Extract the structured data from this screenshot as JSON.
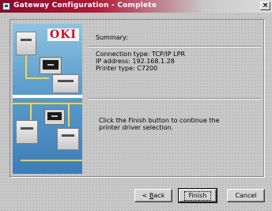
{
  "window": {
    "title": "Gateway Configuration - Complete",
    "close_glyph": "×"
  },
  "artwork": {
    "logo_text": "OKI"
  },
  "summary": {
    "heading": "Summary:",
    "connection_type": "Connection type: TCP/IP LPR",
    "ip_address": "IP address: 192.168.1.28",
    "printer_type": "Printer type: C7200"
  },
  "instructions": {
    "line1": "Click the Finish button to continue the",
    "line2": "printer driver selection."
  },
  "buttons": {
    "back_prefix": "< ",
    "back_mnemonic": "B",
    "back_rest": "ack",
    "finish": "Finish",
    "cancel": "Cancel"
  },
  "icons": {
    "app": "window-icon",
    "close": "close-icon"
  }
}
